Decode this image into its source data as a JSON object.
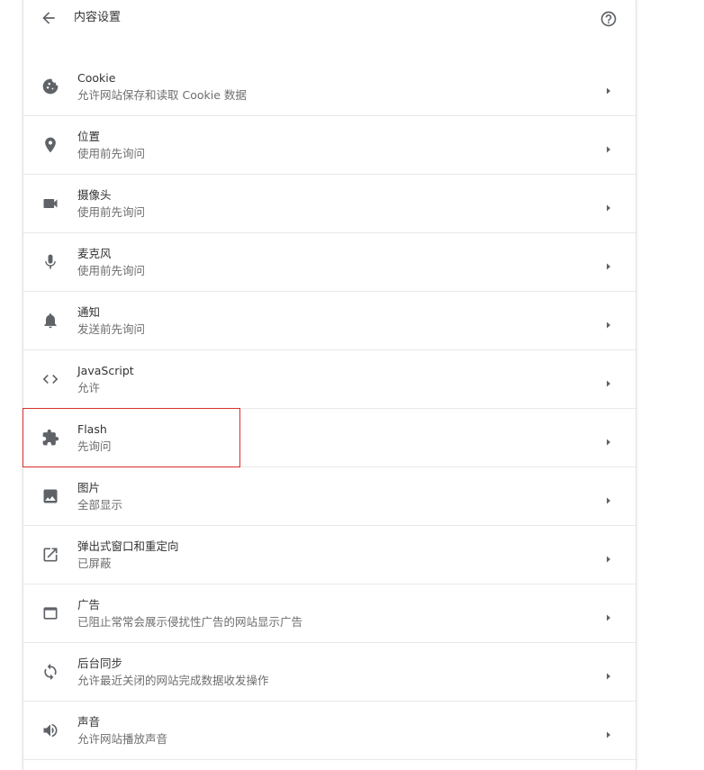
{
  "header": {
    "title": "内容设置",
    "back_icon": "arrow-back-icon",
    "help_icon": "help-circle-icon"
  },
  "colors": {
    "icon": "#5f6368",
    "highlight_border": "#d9302c"
  },
  "settings": [
    {
      "key": "cookie",
      "icon": "cookie-icon",
      "title": "Cookie",
      "subtitle": "允许网站保存和读取 Cookie 数据"
    },
    {
      "key": "location",
      "icon": "location-pin-icon",
      "title": "位置",
      "subtitle": "使用前先询问"
    },
    {
      "key": "camera",
      "icon": "camera-icon",
      "title": "摄像头",
      "subtitle": "使用前先询问"
    },
    {
      "key": "microphone",
      "icon": "microphone-icon",
      "title": "麦克风",
      "subtitle": "使用前先询问"
    },
    {
      "key": "notifications",
      "icon": "bell-icon",
      "title": "通知",
      "subtitle": "发送前先询问"
    },
    {
      "key": "javascript",
      "icon": "code-brackets-icon",
      "title": "JavaScript",
      "subtitle": "允许"
    },
    {
      "key": "flash",
      "icon": "puzzle-piece-icon",
      "title": "Flash",
      "subtitle": "先询问"
    },
    {
      "key": "images",
      "icon": "image-icon",
      "title": "图片",
      "subtitle": "全部显示"
    },
    {
      "key": "popups",
      "icon": "open-in-new-icon",
      "title": "弹出式窗口和重定向",
      "subtitle": "已屏蔽"
    },
    {
      "key": "ads",
      "icon": "browser-window-icon",
      "title": "广告",
      "subtitle": "已阻止常常会展示侵扰性广告的网站显示广告"
    },
    {
      "key": "background-sync",
      "icon": "sync-icon",
      "title": "后台同步",
      "subtitle": "允许最近关闭的网站完成数据收发操作"
    },
    {
      "key": "sound",
      "icon": "speaker-icon",
      "title": "声音",
      "subtitle": "允许网站播放声音"
    }
  ]
}
